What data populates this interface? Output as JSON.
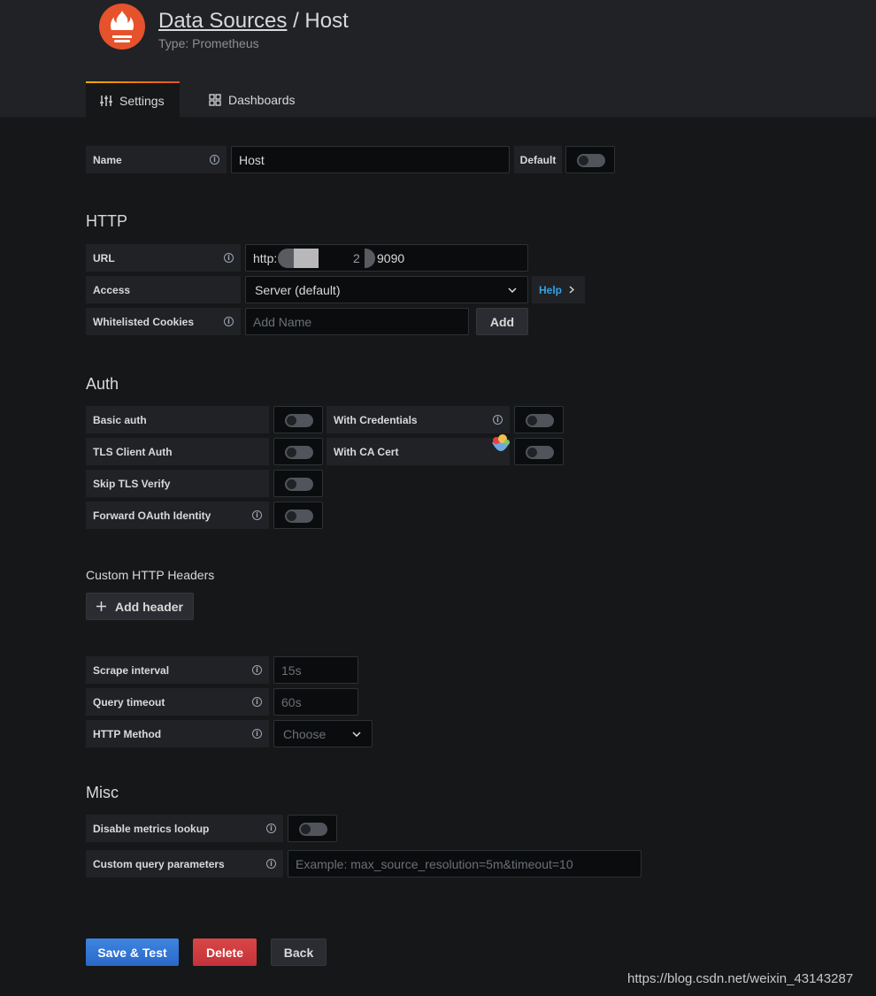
{
  "header": {
    "breadcrumb_link": "Data Sources",
    "separator": "/",
    "name": "Host",
    "type": "Type: Prometheus"
  },
  "tabs": [
    {
      "label": "Settings",
      "active": true,
      "icon": "sliders-icon"
    },
    {
      "label": "Dashboards",
      "active": false,
      "icon": "apps-icon"
    }
  ],
  "name_row": {
    "label": "Name",
    "value": "Host",
    "default_label": "Default",
    "default_on": false
  },
  "http": {
    "title": "HTTP",
    "url_label": "URL",
    "url_prefix": "http:",
    "url_suffix": "2",
    "url_port": "9090",
    "access_label": "Access",
    "access_value": "Server (default)",
    "help_label": "Help",
    "cookies_label": "Whitelisted Cookies",
    "cookies_placeholder": "Add Name",
    "add_label": "Add"
  },
  "auth": {
    "title": "Auth",
    "basic_auth": "Basic auth",
    "tls_client_auth": "TLS Client Auth",
    "skip_tls_verify": "Skip TLS Verify",
    "forward_oauth": "Forward OAuth Identity",
    "with_credentials": "With Credentials",
    "with_ca_cert": "With CA Cert"
  },
  "custom_headers": {
    "title": "Custom HTTP Headers",
    "add_header": "Add header"
  },
  "prometheus": {
    "scrape_label": "Scrape interval",
    "scrape_placeholder": "15s",
    "timeout_label": "Query timeout",
    "timeout_placeholder": "60s",
    "method_label": "HTTP Method",
    "method_placeholder": "Choose"
  },
  "misc": {
    "title": "Misc",
    "disable_lookup": "Disable metrics lookup",
    "custom_params": "Custom query parameters",
    "custom_params_placeholder": "Example: max_source_resolution=5m&timeout=10"
  },
  "actions": {
    "save": "Save & Test",
    "delete": "Delete",
    "back": "Back"
  },
  "watermark": "https://blog.csdn.net/weixin_43143287",
  "colors": {
    "primary": "#3274d9",
    "danger": "#d44a3a",
    "help": "#33a2e5",
    "logo": "#e6522c"
  }
}
